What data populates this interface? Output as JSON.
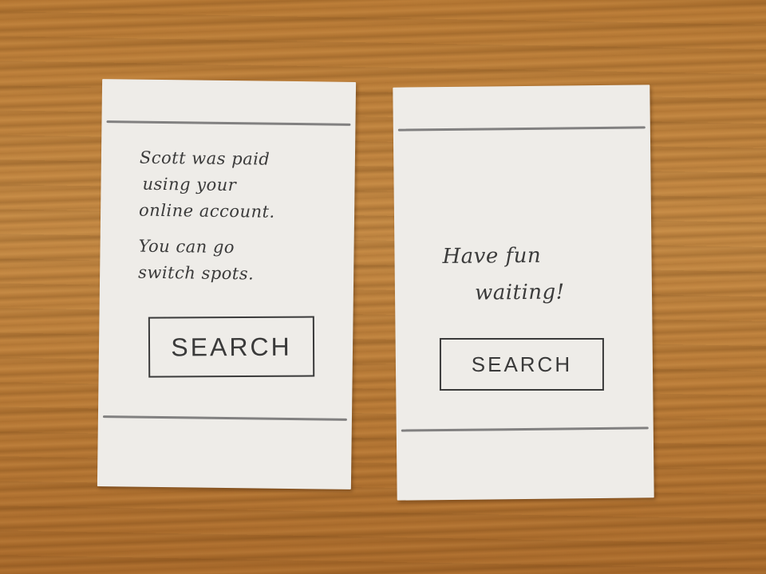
{
  "cards": [
    {
      "message_lines": [
        "Scott was paid",
        "using your",
        "online account.",
        "You can go",
        "switch spots."
      ],
      "search_label": "SEARCH"
    },
    {
      "message_lines": [
        "Have fun",
        "waiting!"
      ],
      "search_label": "SEARCH"
    }
  ]
}
